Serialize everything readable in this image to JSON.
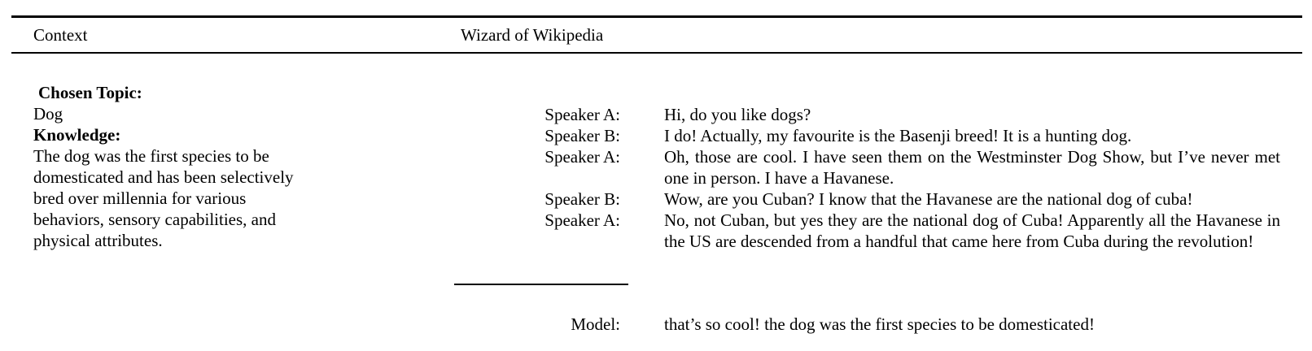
{
  "header": {
    "context_label": "Context",
    "dataset_label": "Wizard of Wikipedia"
  },
  "context": {
    "topic_heading": "Chosen Topic:",
    "topic_value": "Dog",
    "knowledge_heading": "Knowledge:",
    "knowledge_lines": [
      "The dog was the first species to be",
      "domesticated and has been selectively",
      "bred over millennia for various",
      "behaviors, sensory capabilities, and",
      "physical attributes."
    ]
  },
  "dialogue": [
    {
      "speaker": "Speaker A:",
      "text": "Hi, do you like dogs?"
    },
    {
      "speaker": "Speaker B:",
      "text": "I do! Actually, my favourite is the Basenji breed! It is a hunting dog."
    },
    {
      "speaker": "Speaker A:",
      "text": "Oh, those are cool. I have seen them on the Westminster Dog Show, but I’ve never met one in person. I have a Havanese."
    },
    {
      "speaker": "Speaker B:",
      "text": "Wow, are you Cuban? I know that the Havanese are the national dog of cuba!"
    },
    {
      "speaker": "Speaker A:",
      "text": "No, not Cuban, but yes they are the national dog of Cuba!  Apparently all the Havanese in the US are descended from a handful that came here from Cuba during the revolution!"
    }
  ],
  "model_response": {
    "speaker": "Model:",
    "text": "that’s so cool! the dog was the first species to be domesticated!"
  }
}
